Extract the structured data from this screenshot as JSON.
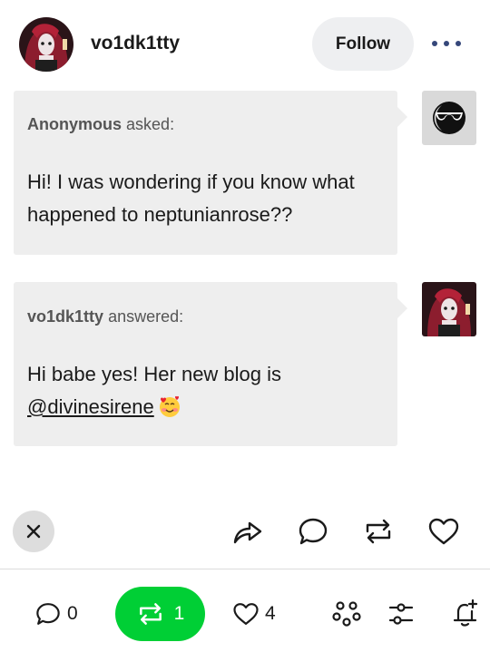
{
  "post": {
    "username": "vo1dk1tty",
    "follow_label": "Follow",
    "more_icon": "more-horizontal-icon"
  },
  "ask": {
    "asker": "Anonymous",
    "verb": "asked:",
    "message": "Hi! I was wondering if you know what happened to neptunianrose??"
  },
  "answer": {
    "answerer": "vo1dk1tty",
    "verb": "answered:",
    "message": "Hi babe yes! Her new blog is",
    "mention": "@divinesirene",
    "emoji": "smiling-face-with-hearts"
  },
  "actions": [
    "close-icon",
    "share-icon",
    "reply-icon",
    "reblog-icon",
    "heart-icon"
  ],
  "footer": {
    "replies": "0",
    "reblogs": "1",
    "likes": "4"
  },
  "colors": {
    "accent_green": "#00cf35",
    "bubble_gray": "#eeeeee",
    "icon_navy": "#35477a"
  }
}
